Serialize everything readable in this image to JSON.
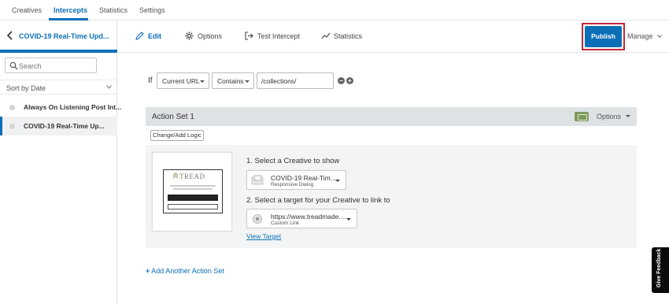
{
  "top_tabs": [
    {
      "label": "Creatives"
    },
    {
      "label": "Intercepts"
    },
    {
      "label": "Statistics"
    },
    {
      "label": "Settings"
    }
  ],
  "sidebar": {
    "title": "COVID-19 Real-Time Upd...",
    "search_placeholder": "Search",
    "sort_label": "Sort by Date",
    "items": [
      {
        "label": "Always On Listening Post Int..."
      },
      {
        "label": "COVID-19 Real-Time Up..."
      }
    ]
  },
  "toolbar": {
    "edit": "Edit",
    "options": "Options",
    "test_intercept": "Test Intercept",
    "statistics": "Statistics",
    "publish": "Publish",
    "manage": "Manage"
  },
  "condition": {
    "if_label": "If",
    "field": "Current URL",
    "operator": "Contains",
    "value": "/collections/"
  },
  "action_set": {
    "title": "Action Set 1",
    "options": "Options",
    "change_logic": "Change/Add Logic",
    "step1_title": "1. Select a Creative to show",
    "creative_name": "COVID-19 Real-Tim...",
    "creative_type": "Responsive Dialog",
    "step2_title": "2. Select a target for your Creative to link to",
    "target_url": "https://www.treadmade....",
    "target_type": "Custom Link",
    "view_target": "View Target",
    "thumbnail": {
      "logo": "TREAD"
    }
  },
  "add_action_set": "Add Another Action Set",
  "feedback_tab": "Give Feedback",
  "colors": {
    "accent": "#0b6fb8",
    "highlight_outline": "#c0273a",
    "badge": "#7d9a5a"
  }
}
